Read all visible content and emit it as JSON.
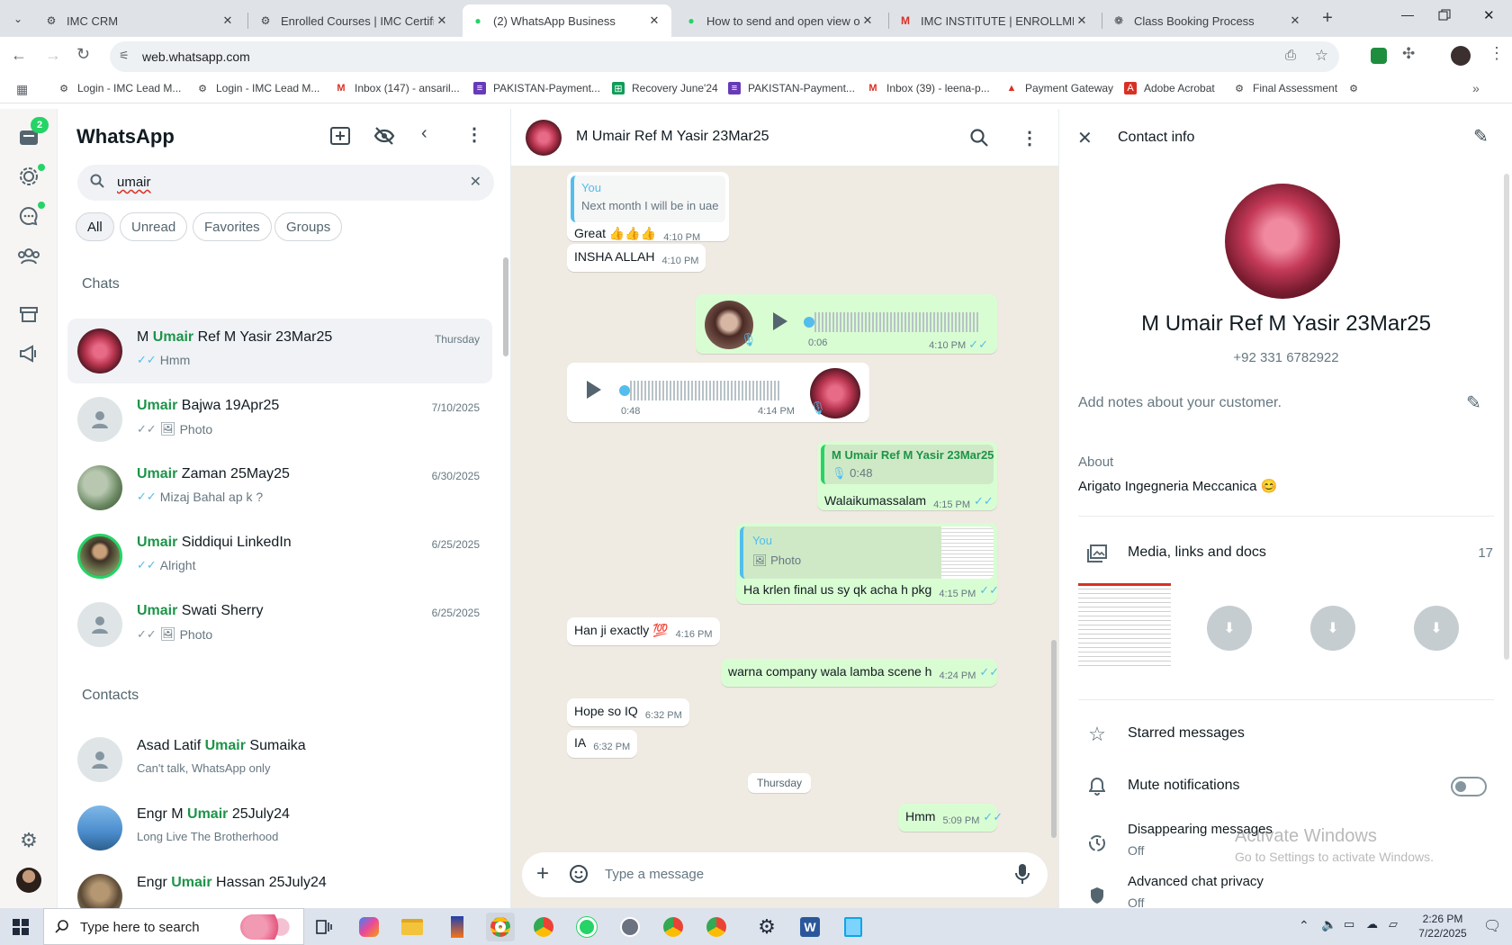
{
  "browser": {
    "tabs": [
      {
        "title": "IMC CRM",
        "active": false
      },
      {
        "title": "Enrolled Courses | IMC Certifica",
        "active": false
      },
      {
        "title": "(2) WhatsApp Business",
        "active": true
      },
      {
        "title": "How to send and open view on",
        "active": false
      },
      {
        "title": "IMC INSTITUTE | ENROLLMENT",
        "active": false
      },
      {
        "title": "Class Booking Process",
        "active": false
      }
    ],
    "url": "web.whatsapp.com",
    "bookmarks": [
      "Login - IMC Lead M...",
      "Login - IMC Lead M...",
      "Inbox (147) - ansaril...",
      "PAKISTAN-Payment...",
      "Recovery June'24",
      "PAKISTAN-Payment...",
      "Inbox (39) - leena-p...",
      "Payment Gateway",
      "Adobe Acrobat",
      "Final Assessment"
    ]
  },
  "rail": {
    "badge": "2"
  },
  "left": {
    "title": "WhatsApp",
    "search_value": "umair",
    "filters": [
      "All",
      "Unread",
      "Favorites",
      "Groups"
    ],
    "chats_header": "Chats",
    "contacts_header": "Contacts",
    "chats": [
      {
        "pre": "M ",
        "hl": "Umair",
        "post": " Ref M Yasir 23Mar25",
        "date": "Thursday",
        "preview": "Hmm"
      },
      {
        "pre": "",
        "hl": "Umair",
        "post": " Bajwa 19Apr25",
        "date": "7/10/2025",
        "preview": "Photo"
      },
      {
        "pre": "",
        "hl": "Umair",
        "post": " Zaman 25May25",
        "date": "6/30/2025",
        "preview": "Mizaj Bahal ap k ?"
      },
      {
        "pre": "",
        "hl": "Umair",
        "post": " Siddiqui LinkedIn",
        "date": "6/25/2025",
        "preview": "Alright"
      },
      {
        "pre": "",
        "hl": "Umair",
        "post": " Swati Sherry",
        "date": "6/25/2025",
        "preview": "Photo"
      }
    ],
    "contacts": [
      {
        "pre": "Asad Latif ",
        "hl": "Umair",
        "post": " Sumaika",
        "status": "Can't talk, WhatsApp only"
      },
      {
        "pre": "Engr M ",
        "hl": "Umair",
        "post": " 25July24",
        "status": "Long Live The Brotherhood"
      },
      {
        "pre": "Engr ",
        "hl": "Umair",
        "post": " Hassan 25July24",
        "status": ""
      }
    ]
  },
  "chat": {
    "name": "M Umair Ref M Yasir 23Mar25",
    "quote_you": "You",
    "quote_text": "Next month I will be in uae",
    "m_great": "Great 👍👍👍",
    "t_410": "4:10 PM",
    "m_insha": "INSHA ALLAH",
    "v1_dur": "0:06",
    "v2_dur": "0:48",
    "t_414": "4:14 PM",
    "q2_name": "M Umair Ref M Yasir 23Mar25",
    "q2_dur": "0:48",
    "m_walaikum": "Walaikumassalam",
    "t_415": "4:15 PM",
    "q3_you": "You",
    "q3_photo": "Photo",
    "m_krlen": "Ha krlen final us sy qk acha h pkg",
    "m_hanji": "Han ji exactly 💯",
    "t_416": "4:16 PM",
    "m_warna": "warna company wala lamba scene h",
    "t_424": "4:24 PM",
    "m_hope": "Hope so IQ",
    "t_632": "6:32 PM",
    "m_ia": "IA",
    "day": "Thursday",
    "m_hmm": "Hmm",
    "t_509": "5:09 PM",
    "composer_placeholder": "Type a message"
  },
  "info": {
    "title": "Contact info",
    "name": "M Umair Ref M Yasir 23Mar25",
    "phone": "+92 331 6782922",
    "notes_placeholder": "Add notes about your customer.",
    "about_label": "About",
    "about": "Arigato Ingegneria Meccanica 😊",
    "media_label": "Media, links and docs",
    "media_count": "17",
    "starred": "Starred messages",
    "mute": "Mute notifications",
    "disappearing": "Disappearing messages",
    "disappearing_sub": "Off",
    "privacy": "Advanced chat privacy",
    "privacy_sub": "Off",
    "watermark1": "Activate Windows",
    "watermark2": "Go to Settings to activate Windows."
  },
  "taskbar": {
    "search_placeholder": "Type here to search",
    "time": "2:26 PM",
    "date": "7/22/2025"
  }
}
